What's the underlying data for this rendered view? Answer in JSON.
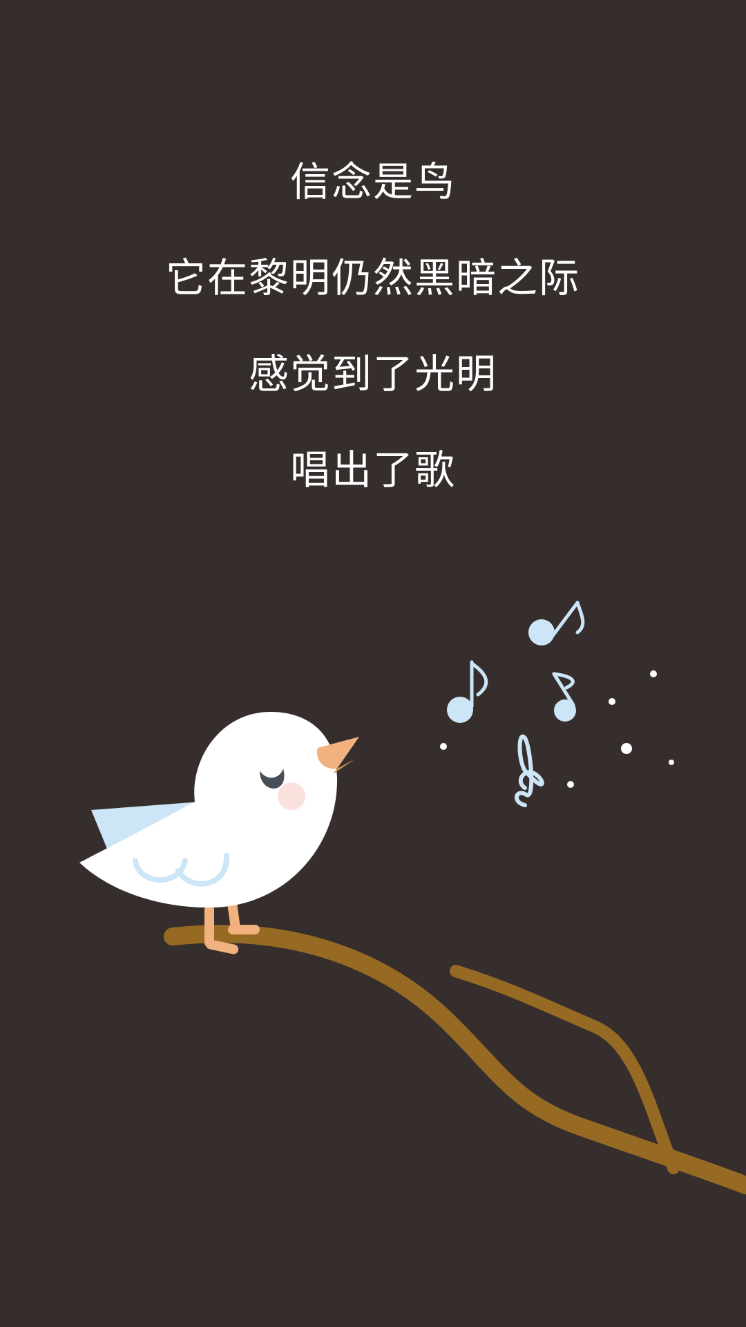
{
  "poem": {
    "lines": [
      "信念是鸟",
      "它在黎明仍然黑暗之际",
      "感觉到了光明",
      "唱出了歌"
    ]
  },
  "colors": {
    "background": "#362e2c",
    "text": "#ffffff",
    "branch": "#976a24",
    "bird_body": "#ffffff",
    "bird_wing": "#cde6f7",
    "beak": "#f2b27f",
    "legs": "#f2b27f",
    "cheek": "#fbe1de",
    "eye": "#464e58",
    "notes": "#cde6f7"
  },
  "illustration": {
    "icons": [
      "bird-icon",
      "branch-icon",
      "music-note-icon",
      "treble-clef-icon"
    ]
  }
}
